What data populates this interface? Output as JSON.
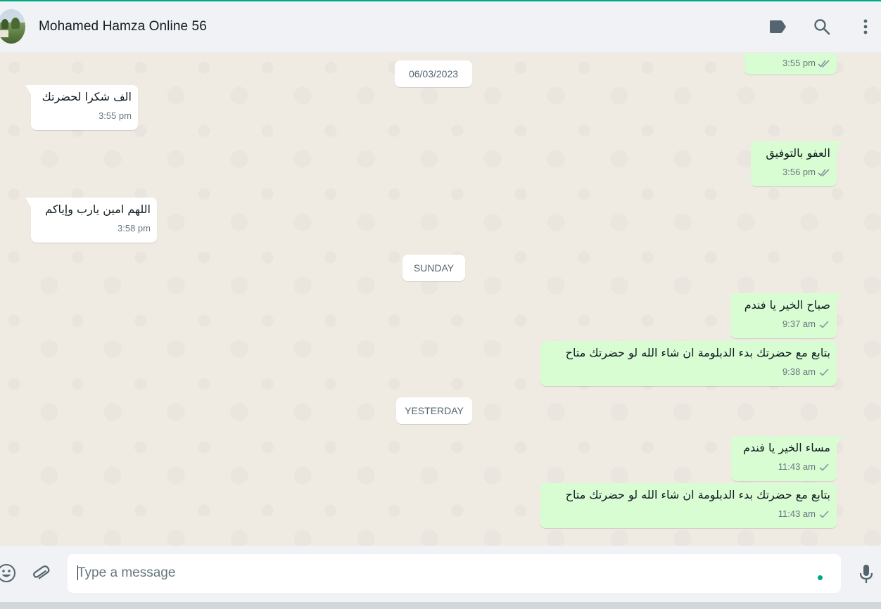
{
  "header": {
    "contact_name": "Mohamed Hamza Online 56",
    "icons": [
      "label-icon",
      "search-icon",
      "menu-icon"
    ]
  },
  "chat": {
    "date_chips": [
      "06/03/2023",
      "SUNDAY",
      "YESTERDAY"
    ],
    "messages": [
      {
        "dir": "out",
        "text": "",
        "time": "3:55 pm",
        "status": "read"
      },
      {
        "dir": "in",
        "text": "الف شكرا لحضرتك",
        "time": "3:55 pm"
      },
      {
        "dir": "out",
        "text": "العفو بالتوفيق",
        "time": "3:56 pm",
        "status": "read"
      },
      {
        "dir": "in",
        "text": "اللهم امين يارب وإياكم",
        "time": "3:58 pm"
      },
      {
        "dir": "out",
        "text": "صباح الخير يا فندم",
        "time": "9:37 am",
        "status": "sent"
      },
      {
        "dir": "out",
        "text": "بتابع مع حضرتك بدء الدبلومة ان شاء الله لو حضرتك متاح",
        "time": "9:38 am",
        "status": "sent"
      },
      {
        "dir": "out",
        "text": "مساء الخير يا فندم",
        "time": "11:43 am",
        "status": "sent"
      },
      {
        "dir": "out",
        "text": "بتابع مع حضرتك بدء الدبلومة ان شاء الله لو حضرتك متاح",
        "time": "11:43 am",
        "status": "sent"
      }
    ]
  },
  "composer": {
    "placeholder": "Type a message",
    "value": ""
  },
  "colors": {
    "accent": "#00a884",
    "outgoing_bubble": "#d9fdd3",
    "incoming_bubble": "#ffffff",
    "chat_background": "#efeae2",
    "read_tick": "#8696a0"
  }
}
